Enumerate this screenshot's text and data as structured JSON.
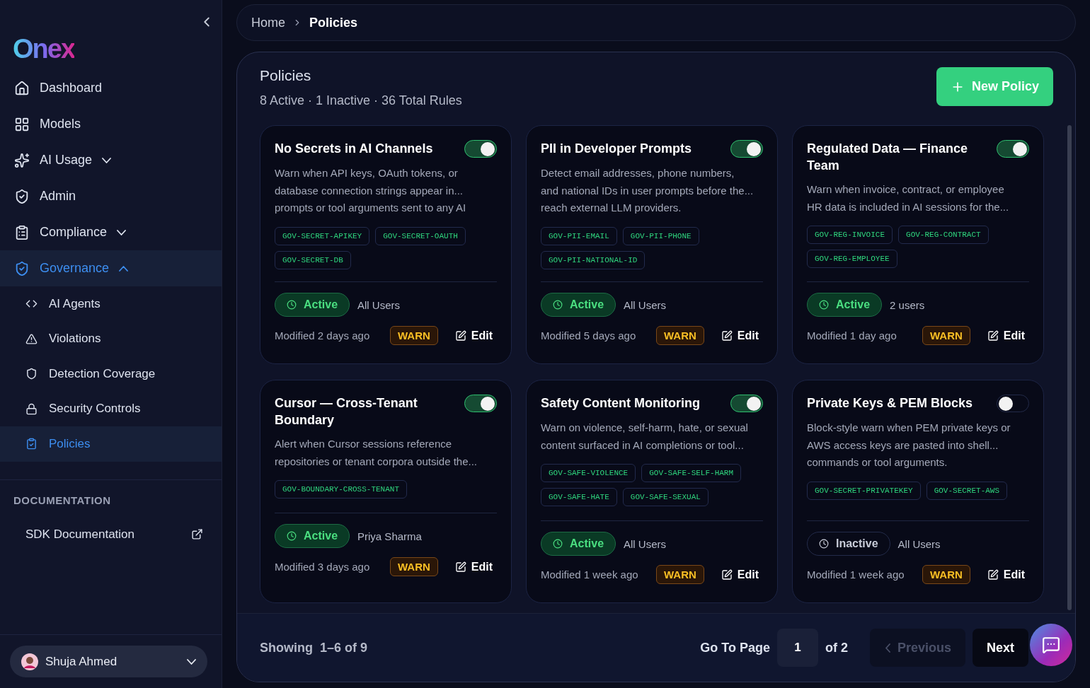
{
  "sidebar": {
    "logo": "Onex",
    "nav": [
      {
        "label": "Dashboard",
        "selected": false
      },
      {
        "label": "Models",
        "selected": false
      },
      {
        "label": "AI Usage",
        "selected": false,
        "expanded": false
      },
      {
        "label": "Admin",
        "selected": false
      },
      {
        "label": "Compliance",
        "selected": false,
        "expanded": false
      },
      {
        "label": "Governance",
        "selected": true,
        "expanded": true,
        "children": [
          {
            "label": "AI Agents",
            "selected": false
          },
          {
            "label": "Violations",
            "selected": false
          },
          {
            "label": "Detection Coverage",
            "selected": false
          },
          {
            "label": "Security Controls",
            "selected": false
          },
          {
            "label": "Policies",
            "selected": true
          }
        ]
      }
    ],
    "section_heading": "DOCUMENTATION",
    "doc_link": "SDK Documentation",
    "user": {
      "name": "Shuja Ahmed"
    }
  },
  "breadcrumb": [
    "Home",
    "Policies"
  ],
  "header": {
    "title": "Policies",
    "summary": "8 Active · 1 Inactive · 36 Total Rules",
    "new_button": "New Policy"
  },
  "policies": [
    {
      "title": "No Secrets in AI Channels",
      "enabled": true,
      "description": "Warn when API keys, OAuth tokens, or\ndatabase connection strings appear in...\nprompts or tool arguments sent to any AI",
      "rules": [
        "GOV-SECRET-APIKEY",
        "GOV-SECRET-OAUTH",
        "GOV-SECRET-DB"
      ],
      "active": true,
      "status": "Active",
      "scope": "All Users",
      "modified": "Modified 2 days ago",
      "action": "WARN",
      "edit": "Edit"
    },
    {
      "title": "PII in Developer Prompts",
      "enabled": true,
      "description": "Detect email addresses, phone numbers,\nand national IDs in user prompts before the...\nreach external LLM providers.",
      "rules": [
        "GOV-PII-EMAIL",
        "GOV-PII-PHONE",
        "GOV-PII-NATIONAL-ID"
      ],
      "active": true,
      "status": "Active",
      "scope": "All Users",
      "modified": "Modified 5 days ago",
      "action": "WARN",
      "edit": "Edit"
    },
    {
      "title": "Regulated Data — Finance Team",
      "enabled": true,
      "description": "Warn when invoice, contract, or employee\nHR data is included in AI sessions for the...",
      "rules": [
        "GOV-REG-INVOICE",
        "GOV-REG-CONTRACT",
        "GOV-REG-EMPLOYEE"
      ],
      "active": true,
      "status": "Active",
      "scope": "2 users",
      "modified": "Modified 1 day ago",
      "action": "WARN",
      "edit": "Edit"
    },
    {
      "title": "Cursor — Cross-Tenant Boundary",
      "enabled": true,
      "description": "Alert when Cursor sessions reference\nrepositories or tenant corpora outside the...",
      "rules": [
        "GOV-BOUNDARY-CROSS-TENANT"
      ],
      "active": true,
      "status": "Active",
      "scope": "Priya Sharma",
      "modified": "Modified 3 days ago",
      "action": "WARN",
      "edit": "Edit"
    },
    {
      "title": "Safety Content Monitoring",
      "enabled": true,
      "description": "Warn on violence, self-harm, hate, or sexual\ncontent surfaced in AI completions or tool...",
      "rules": [
        "GOV-SAFE-VIOLENCE",
        "GOV-SAFE-SELF-HARM",
        "GOV-SAFE-HATE",
        "GOV-SAFE-SEXUAL"
      ],
      "active": true,
      "status": "Active",
      "scope": "All Users",
      "modified": "Modified 1 week ago",
      "action": "WARN",
      "edit": "Edit"
    },
    {
      "title": "Private Keys & PEM Blocks",
      "enabled": false,
      "description": "Block-style warn when PEM private keys or\nAWS access keys are pasted into shell...\ncommands or tool arguments.",
      "rules": [
        "GOV-SECRET-PRIVATEKEY",
        "GOV-SECRET-AWS"
      ],
      "active": false,
      "status": "Inactive",
      "scope": "All Users",
      "modified": "Modified 1 week ago",
      "action": "WARN",
      "edit": "Edit"
    }
  ],
  "pagination": {
    "showing_label": "Showing",
    "range": "1–6 of 9",
    "goto_label": "Go To Page",
    "page": "1",
    "of_pages": "of 2",
    "previous": "Previous",
    "next": "Next",
    "previous_disabled": true
  }
}
